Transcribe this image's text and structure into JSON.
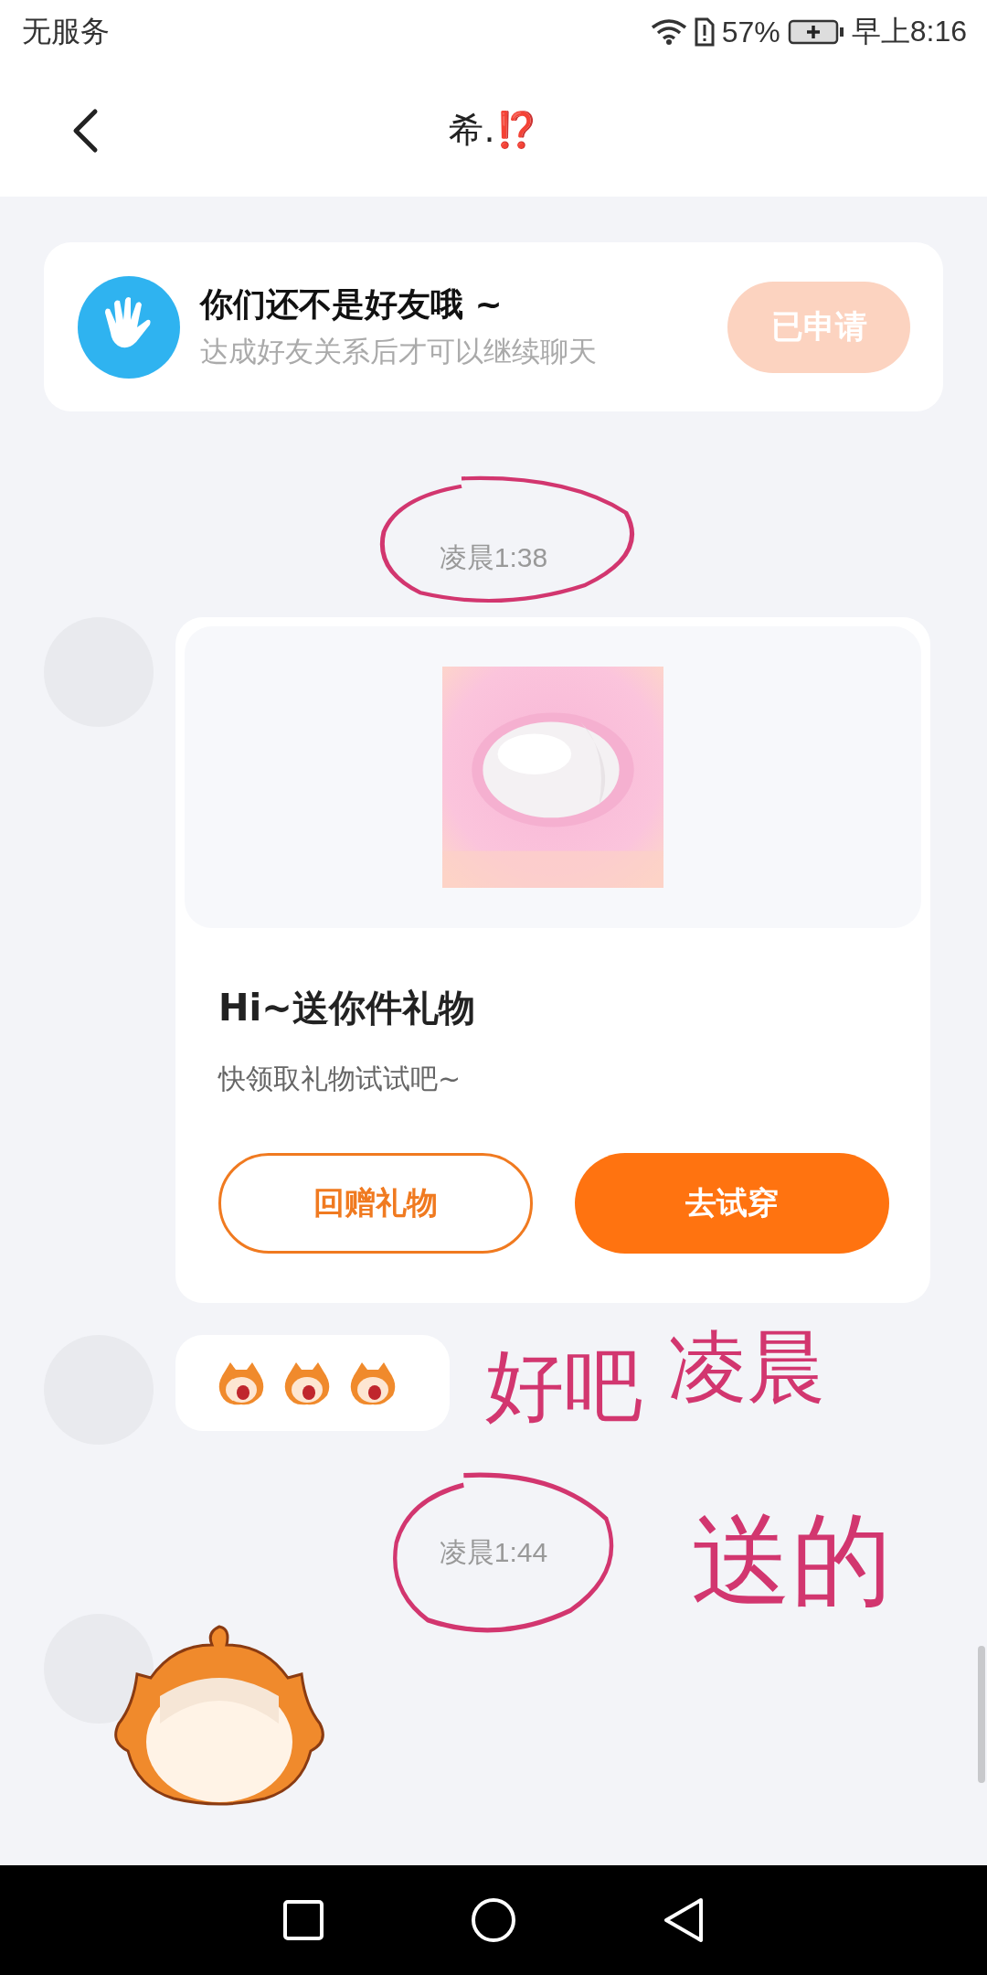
{
  "status_bar": {
    "carrier": "无服务",
    "battery": "57%",
    "time": "早上8:16"
  },
  "header": {
    "title": "希.⁉️"
  },
  "friend_notice": {
    "title": "你们还不是好友哦 ~",
    "subtitle": "达成好友关系后才可以继续聊天",
    "button": "已申请",
    "button_disabled": true
  },
  "messages": [
    {
      "kind": "time",
      "text": "凌晨1:38",
      "circled": true
    },
    {
      "kind": "gift",
      "image": {
        "kind": "picture"
      },
      "title": "Hi~送你件礼物",
      "subtitle": "快领取礼物试试吧~",
      "buttons": [
        {
          "label": "回赠礼物"
        },
        {
          "label": "去试穿"
        }
      ]
    },
    {
      "kind": "stickers",
      "items": [
        {
          "kind": "crying"
        },
        {
          "kind": "crying"
        },
        {
          "kind": "crying"
        }
      ]
    },
    {
      "kind": "time",
      "text": "凌晨1:44",
      "circled": true
    },
    {
      "kind": "sticker"
    }
  ],
  "annotation": {
    "texts": [
      "好吧",
      "凌晨",
      "送的"
    ]
  }
}
